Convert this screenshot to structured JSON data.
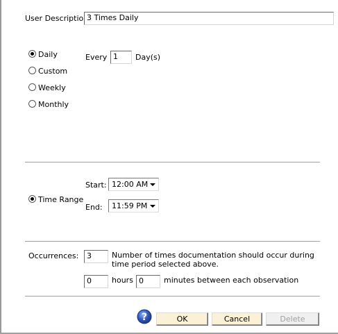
{
  "user_description": {
    "label": "User Description:",
    "value": "3 Times Daily"
  },
  "frequency": {
    "options": [
      {
        "label": "Daily",
        "checked": true
      },
      {
        "label": "Custom",
        "checked": false
      },
      {
        "label": "Weekly",
        "checked": false
      },
      {
        "label": "Monthly",
        "checked": false
      }
    ],
    "every_label": "Every",
    "every_value": "1",
    "unit_label": "Day(s)"
  },
  "time_range": {
    "radio_label": "Time Range",
    "checked": true,
    "start_label": "Start:",
    "start_value": "12:00 AM",
    "end_label": "End:",
    "end_value": "11:59 PM"
  },
  "occurrences": {
    "label": "Occurrences:",
    "count_value": "3",
    "count_description": "Number of times documentation should occur during time period selected above.",
    "hours_value": "0",
    "hours_label": "hours",
    "minutes_value": "0",
    "minutes_label": "minutes between each observation"
  },
  "buttons": {
    "ok": "OK",
    "cancel": "Cancel",
    "delete": "Delete"
  },
  "icons": {
    "help": "help-icon"
  },
  "colors": {
    "button_bg": "#fbf1d6",
    "help_icon": "#2f56b8"
  }
}
